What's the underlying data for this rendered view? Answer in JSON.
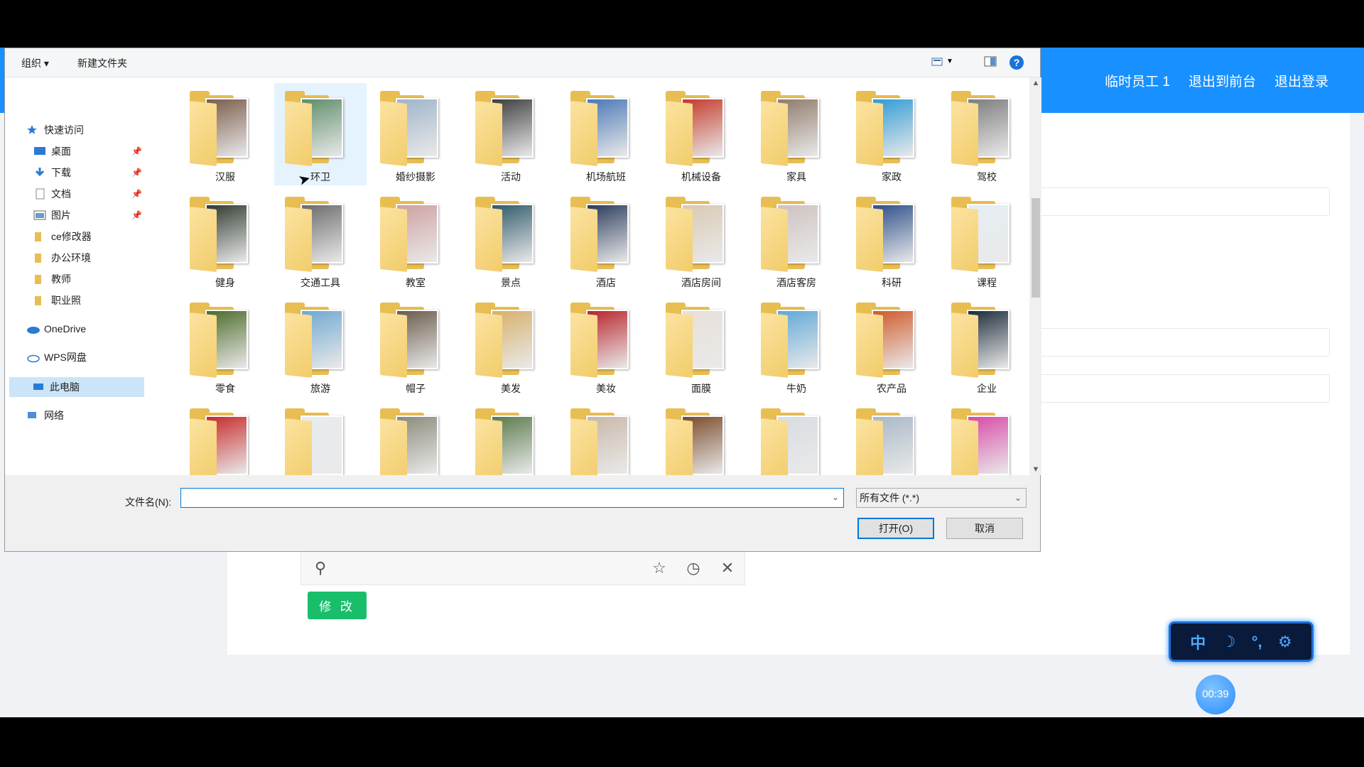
{
  "app": {
    "nav": [
      "临时员工 1",
      "退出到前台",
      "退出登录"
    ],
    "modify_label": "修 改",
    "timer": "00:39",
    "ime": [
      "中",
      "☽",
      "°,",
      "⚙"
    ],
    "accent": "#1890ff",
    "button_color": "#19be6b"
  },
  "dialog": {
    "toolbar": {
      "organize": "组织 ▾",
      "new_folder": "新建文件夹",
      "help": "?"
    },
    "nav": {
      "quick_access": "快速访问",
      "items": [
        {
          "label": "桌面",
          "icon": "desktop-icon",
          "pinned": true
        },
        {
          "label": "下载",
          "icon": "download-icon",
          "pinned": true
        },
        {
          "label": "文档",
          "icon": "document-icon",
          "pinned": true
        },
        {
          "label": "图片",
          "icon": "picture-icon",
          "pinned": true
        },
        {
          "label": "ce修改器",
          "icon": "folder-icon",
          "pinned": false
        },
        {
          "label": "办公环境",
          "icon": "folder-icon",
          "pinned": false
        },
        {
          "label": "教师",
          "icon": "folder-icon",
          "pinned": false
        },
        {
          "label": "职业照",
          "icon": "folder-icon",
          "pinned": false
        }
      ],
      "onedrive": "OneDrive",
      "wps": "WPS网盘",
      "this_pc": "此电脑",
      "network": "网络"
    },
    "folders": [
      [
        "汉服",
        "环卫",
        "婚纱摄影",
        "活动",
        "机场航班",
        "机械设备",
        "家具",
        "家政",
        "驾校"
      ],
      [
        "健身",
        "交通工具",
        "教室",
        "景点",
        "酒店",
        "酒店房间",
        "酒店客房",
        "科研",
        "课程"
      ],
      [
        "零食",
        "旅游",
        "帽子",
        "美发",
        "美妆",
        "面膜",
        "牛奶",
        "农产品",
        "企业"
      ],
      [
        "",
        "",
        "",
        "",
        "",
        "",
        "",
        "",
        ""
      ]
    ],
    "selected_folder": "环卫",
    "filename_label": "文件名(N):",
    "filename_value": "",
    "filetype": "所有文件 (*.*)",
    "open_label": "打开(O)",
    "cancel_label": "取消"
  }
}
